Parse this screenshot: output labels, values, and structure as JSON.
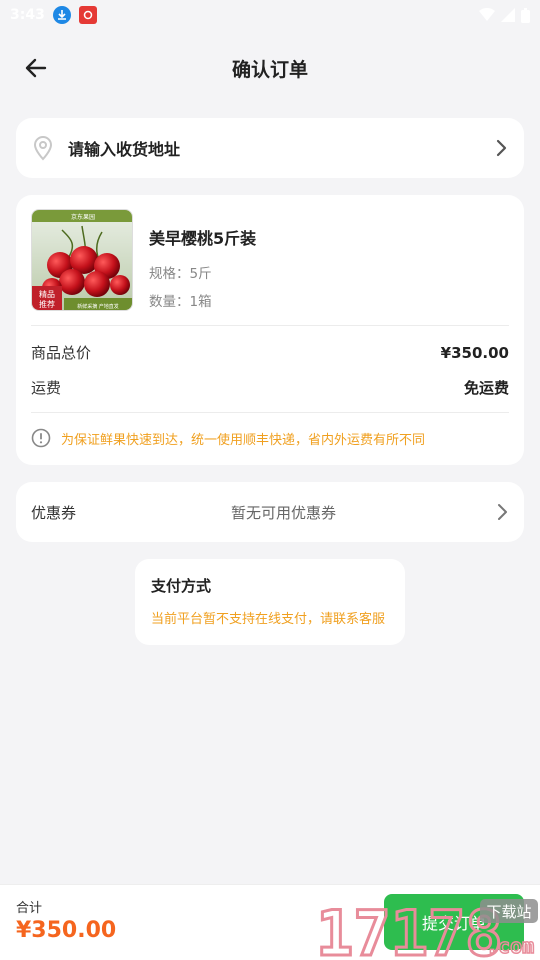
{
  "status_bar": {
    "time": "3:43"
  },
  "header": {
    "title": "确认订单"
  },
  "address": {
    "placeholder": "请输入收货地址"
  },
  "product": {
    "name": "美早樱桃5斤装",
    "spec": "规格：5斤",
    "quantity": "数量：1箱",
    "image_badge": "精品推荐",
    "image_top_text": "京东果园",
    "image_bottom_text": "新鲜采摘 产地直发"
  },
  "summary": {
    "total_label": "商品总价",
    "total_value": "¥350.00",
    "shipping_label": "运费",
    "shipping_value": "免运费",
    "notice": "为保证鲜果快速到达，统一使用顺丰快递，省内外运费有所不同"
  },
  "coupon": {
    "label": "优惠券",
    "value": "暂无可用优惠券"
  },
  "payment": {
    "title": "支付方式",
    "note": "当前平台暂不支持在线支付，请联系客服"
  },
  "footer": {
    "total_label": "合计",
    "total_value": "¥350.00",
    "submit_label": "提交订单"
  },
  "watermark": {
    "text": "17178",
    "suffix": "下载站",
    "domain": ".com"
  },
  "colors": {
    "accent": "#f5651e",
    "notice": "#f0a020",
    "button": "#2ebd4f",
    "background": "#f4f4f6"
  }
}
